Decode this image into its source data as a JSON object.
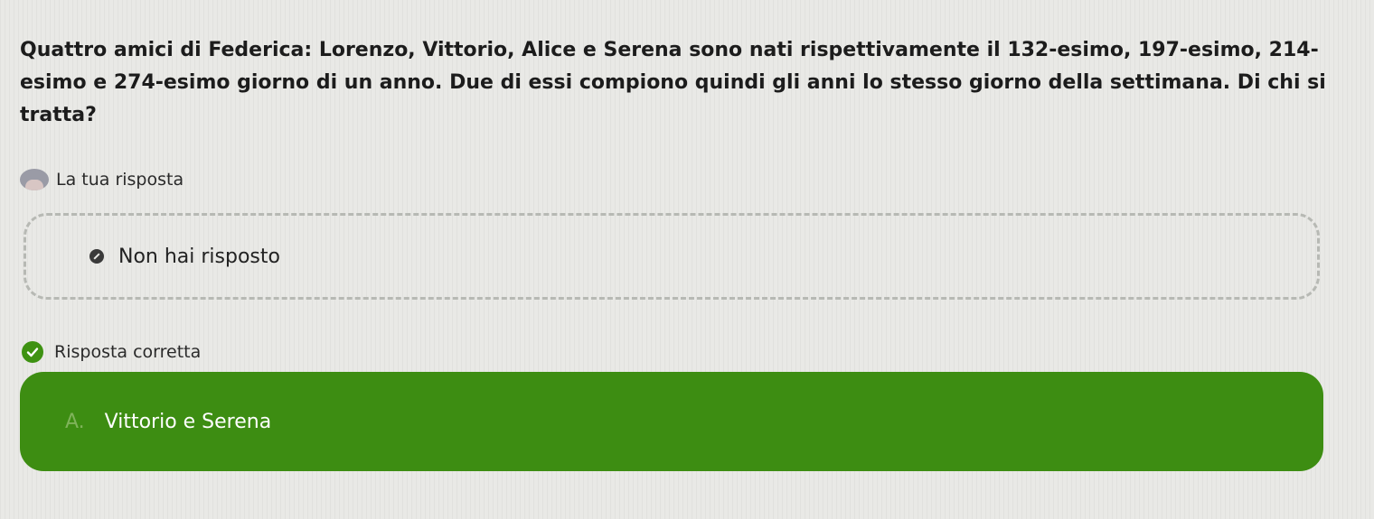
{
  "question": {
    "text": "Quattro amici di Federica: Lorenzo, Vittorio, Alice e Serena sono nati rispettivamente il 132-esimo, 197-esimo, 214-esimo e 274-esimo giorno di un anno. Due di essi compiono quindi gli anni lo stesso giorno della settimana. Di chi si tratta?"
  },
  "your_answer": {
    "label": "La tua risposta",
    "status_text": "Non hai risposto"
  },
  "correct_answer": {
    "label": "Risposta corretta",
    "option_letter": "A.",
    "option_text": "Vittorio e Serena"
  },
  "colors": {
    "background": "#e9e9e6",
    "correct_green": "#3d8d12",
    "dashed_border": "#b7b9b4"
  },
  "icons": {
    "avatar": "user-avatar-icon",
    "not_answered": "not-answered-icon",
    "correct": "check-circle-icon"
  }
}
